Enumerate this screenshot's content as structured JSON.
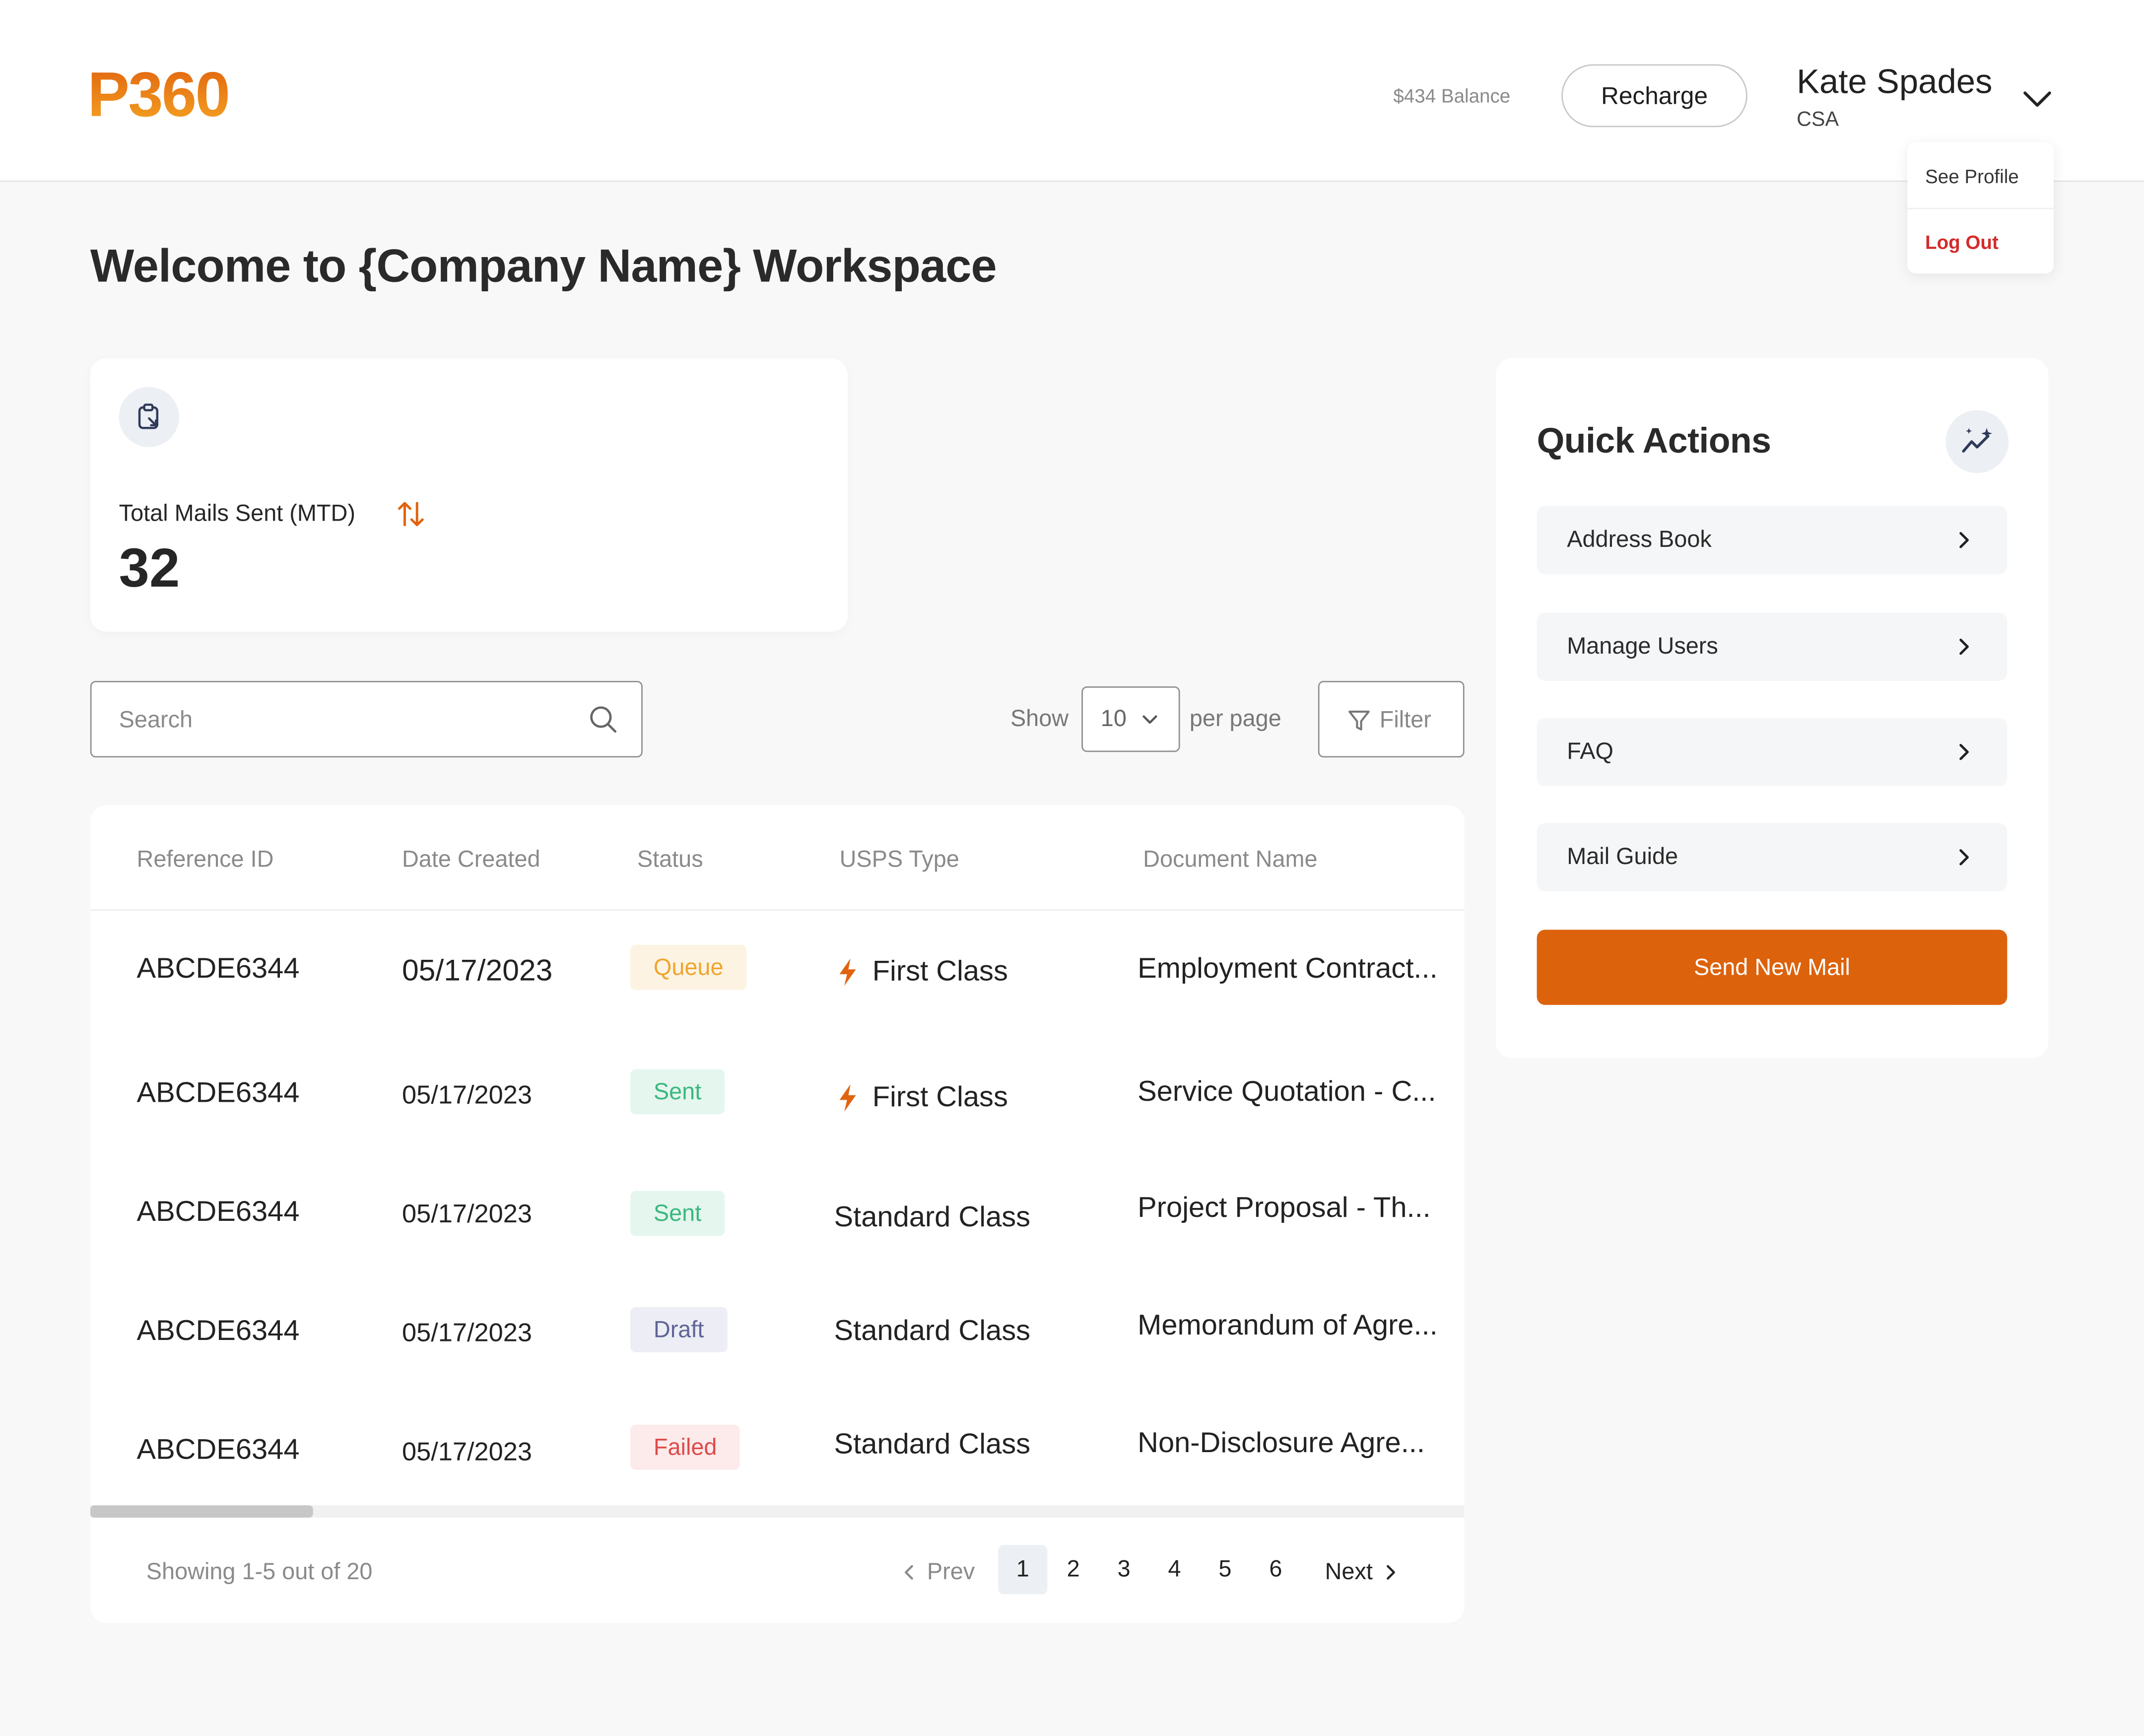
{
  "header": {
    "logo_text": "P360",
    "balance": "$434 Balance",
    "recharge_label": "Recharge",
    "user_name": "Kate Spades",
    "user_role": "CSA",
    "menu": {
      "see_profile": "See Profile",
      "log_out": "Log Out"
    }
  },
  "page_title": "Welcome to {Company Name} Workspace",
  "stat": {
    "label": "Total Mails Sent (MTD)",
    "value": "32"
  },
  "search": {
    "placeholder": "Search"
  },
  "per_page": {
    "show_label": "Show",
    "value": "10",
    "suffix": "per page"
  },
  "filter_label": "Filter",
  "table": {
    "columns": [
      "Reference ID",
      "Date Created",
      "Status",
      "USPS Type",
      "Document Name"
    ],
    "rows": [
      {
        "ref": "ABCDE6344",
        "date": "05/17/2023",
        "status": "Queue",
        "usps": "First Class",
        "doc": "Employment Contract..."
      },
      {
        "ref": "ABCDE6344",
        "date": "05/17/2023",
        "status": "Sent",
        "usps": "First Class",
        "doc": "Service Quotation - C..."
      },
      {
        "ref": "ABCDE6344",
        "date": "05/17/2023",
        "status": "Sent",
        "usps": "Standard Class",
        "doc": "Project Proposal - Th..."
      },
      {
        "ref": "ABCDE6344",
        "date": "05/17/2023",
        "status": "Draft",
        "usps": "Standard Class",
        "doc": "Memorandum of Agre..."
      },
      {
        "ref": "ABCDE6344",
        "date": "05/17/2023",
        "status": "Failed",
        "usps": "Standard Class",
        "doc": "Non-Disclosure Agre..."
      }
    ]
  },
  "pagination": {
    "showing": "Showing 1-5 out of 20",
    "prev": "Prev",
    "next": "Next",
    "pages": [
      "1",
      "2",
      "3",
      "4",
      "5",
      "6"
    ],
    "active_page": "1"
  },
  "quick_actions": {
    "title": "Quick Actions",
    "items": [
      "Address Book",
      "Manage Users",
      "FAQ",
      "Mail Guide"
    ],
    "send_label": "Send New Mail"
  },
  "colors": {
    "brand_orange": "#dc620c",
    "logo_gradient_start": "#e0600f",
    "logo_gradient_end": "#f5a623",
    "queue": "#eea52d",
    "sent": "#3bb77f",
    "draft": "#5f6496",
    "failed": "#dd4b4b",
    "logout_red": "#d42b2b"
  },
  "icons": {
    "stat": "clipboard-icon",
    "sort": "sort-arrows-icon",
    "search": "search-icon",
    "filter": "filter-icon",
    "usps_first_class": "lightning-icon",
    "quick_actions": "sparkle-chart-icon",
    "chevron": "chevron-right-icon"
  }
}
